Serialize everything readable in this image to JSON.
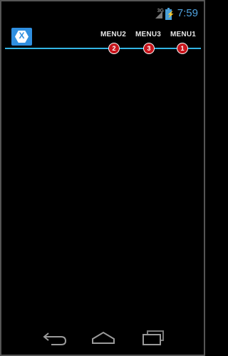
{
  "status_bar": {
    "network_type": "3G",
    "time": "7:59",
    "icons": [
      "signal-icon",
      "battery-charging-icon"
    ]
  },
  "action_bar": {
    "app_icon": "xamarin-logo-icon",
    "logo_letter": "X",
    "menu_items": [
      {
        "label": "MENU2",
        "badge": "2"
      },
      {
        "label": "MENU3",
        "badge": "3"
      },
      {
        "label": "MENU1",
        "badge": "1"
      }
    ],
    "accent_color": "#33b5e5"
  },
  "nav_bar": {
    "buttons": [
      "back-icon",
      "home-icon",
      "recent-apps-icon"
    ]
  }
}
